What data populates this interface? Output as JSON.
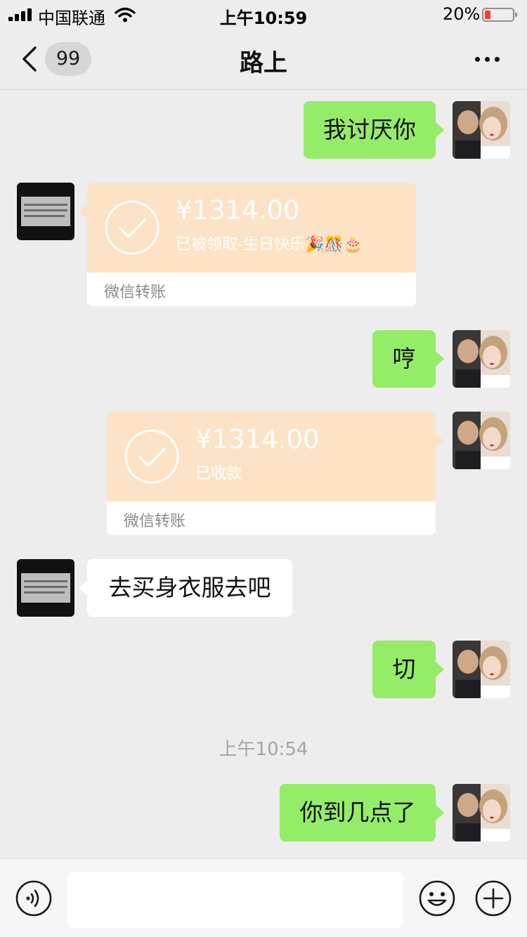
{
  "status_bar": {
    "carrier": "中国联通",
    "time": "上午10:59",
    "battery_percent": "20%",
    "battery_level": 0.2
  },
  "nav": {
    "back_badge": "99",
    "title": "路上",
    "more_icon": "more-dots-icon"
  },
  "messages": {
    "m1": {
      "text": "我讨厌你"
    },
    "m2": {
      "amount": "¥1314.00",
      "status": "已被领取-生日快乐🎉🎊🎂",
      "label": "微信转账"
    },
    "m3": {
      "text": "哼"
    },
    "m4": {
      "amount": "¥1314.00",
      "status": "已收款",
      "label": "微信转账"
    },
    "m5": {
      "text": "去买身衣服去吧"
    },
    "m6": {
      "text": "切"
    },
    "timestamp": "上午10:54",
    "m7": {
      "text": "你到几点了"
    }
  },
  "input_bar": {
    "voice_icon": "voice-icon",
    "input_value": "",
    "emoji_icon": "emoji-icon",
    "plus_icon": "plus-icon"
  },
  "colors": {
    "background": "#ededed",
    "my_bubble": "#95ec69",
    "their_bubble": "#ffffff",
    "transfer_card": "#fde3c6",
    "battery_low": "#ff3b30"
  }
}
